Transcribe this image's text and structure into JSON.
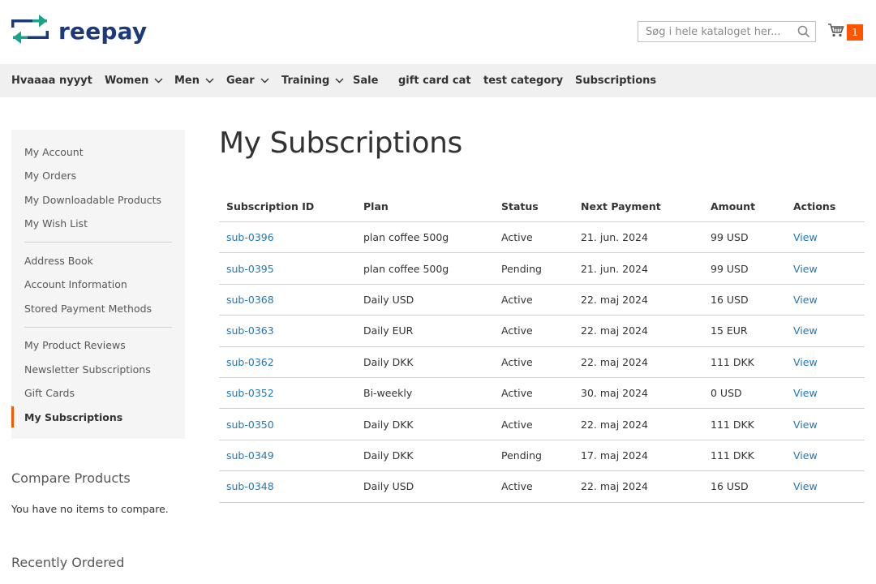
{
  "header": {
    "logo_text": "reepay",
    "search_placeholder": "Søg i hele kataloget her...",
    "cart_count": "1"
  },
  "colors": {
    "accent": "#ff5501",
    "link": "#1979c3",
    "logo_blue": "#1c3a7a",
    "logo_teal": "#1aa38a"
  },
  "nav": {
    "items": [
      {
        "label": "Hvaaaa nyyyt",
        "has_dropdown": false
      },
      {
        "label": "Women",
        "has_dropdown": true
      },
      {
        "label": "Men",
        "has_dropdown": true
      },
      {
        "label": "Gear",
        "has_dropdown": true
      },
      {
        "label": "Training",
        "has_dropdown": true
      },
      {
        "label": "Sale",
        "has_dropdown": false
      },
      {
        "label": "gift card cat",
        "has_dropdown": false
      },
      {
        "label": "test category",
        "has_dropdown": false
      },
      {
        "label": "Subscriptions",
        "has_dropdown": false
      }
    ]
  },
  "sidebar": {
    "items": [
      {
        "label": "My Account"
      },
      {
        "label": "My Orders"
      },
      {
        "label": "My Downloadable Products"
      },
      {
        "label": "My Wish List"
      },
      {
        "label": "Address Book"
      },
      {
        "label": "Account Information"
      },
      {
        "label": "Stored Payment Methods"
      },
      {
        "label": "My Product Reviews"
      },
      {
        "label": "Newsletter Subscriptions"
      },
      {
        "label": "Gift Cards"
      },
      {
        "label": "My Subscriptions",
        "active": true
      }
    ]
  },
  "compare": {
    "title": "Compare Products",
    "text": "You have no items to compare."
  },
  "recent": {
    "title": "Recently Ordered"
  },
  "main": {
    "title": "My Subscriptions",
    "columns": [
      "Subscription ID",
      "Plan",
      "Status",
      "Next Payment",
      "Amount",
      "Actions"
    ],
    "rows": [
      {
        "id": "sub-0396",
        "plan": "plan coffee 500g",
        "status": "Active",
        "next": "21. jun. 2024",
        "amount": "99 USD",
        "action": "View"
      },
      {
        "id": "sub-0395",
        "plan": "plan coffee 500g",
        "status": "Pending",
        "next": "21. jun. 2024",
        "amount": "99 USD",
        "action": "View"
      },
      {
        "id": "sub-0368",
        "plan": "Daily USD",
        "status": "Active",
        "next": "22. maj 2024",
        "amount": "16 USD",
        "action": "View"
      },
      {
        "id": "sub-0363",
        "plan": "Daily EUR",
        "status": "Active",
        "next": "22. maj 2024",
        "amount": "15 EUR",
        "action": "View"
      },
      {
        "id": "sub-0362",
        "plan": "Daily DKK",
        "status": "Active",
        "next": "22. maj 2024",
        "amount": "111 DKK",
        "action": "View"
      },
      {
        "id": "sub-0352",
        "plan": "Bi-weekly",
        "status": "Active",
        "next": "30. maj 2024",
        "amount": "0 USD",
        "action": "View"
      },
      {
        "id": "sub-0350",
        "plan": "Daily DKK",
        "status": "Active",
        "next": "22. maj 2024",
        "amount": "111 DKK",
        "action": "View"
      },
      {
        "id": "sub-0349",
        "plan": "Daily DKK",
        "status": "Pending",
        "next": "17. maj 2024",
        "amount": "111 DKK",
        "action": "View"
      },
      {
        "id": "sub-0348",
        "plan": "Daily USD",
        "status": "Active",
        "next": "22. maj 2024",
        "amount": "16 USD",
        "action": "View"
      }
    ]
  }
}
